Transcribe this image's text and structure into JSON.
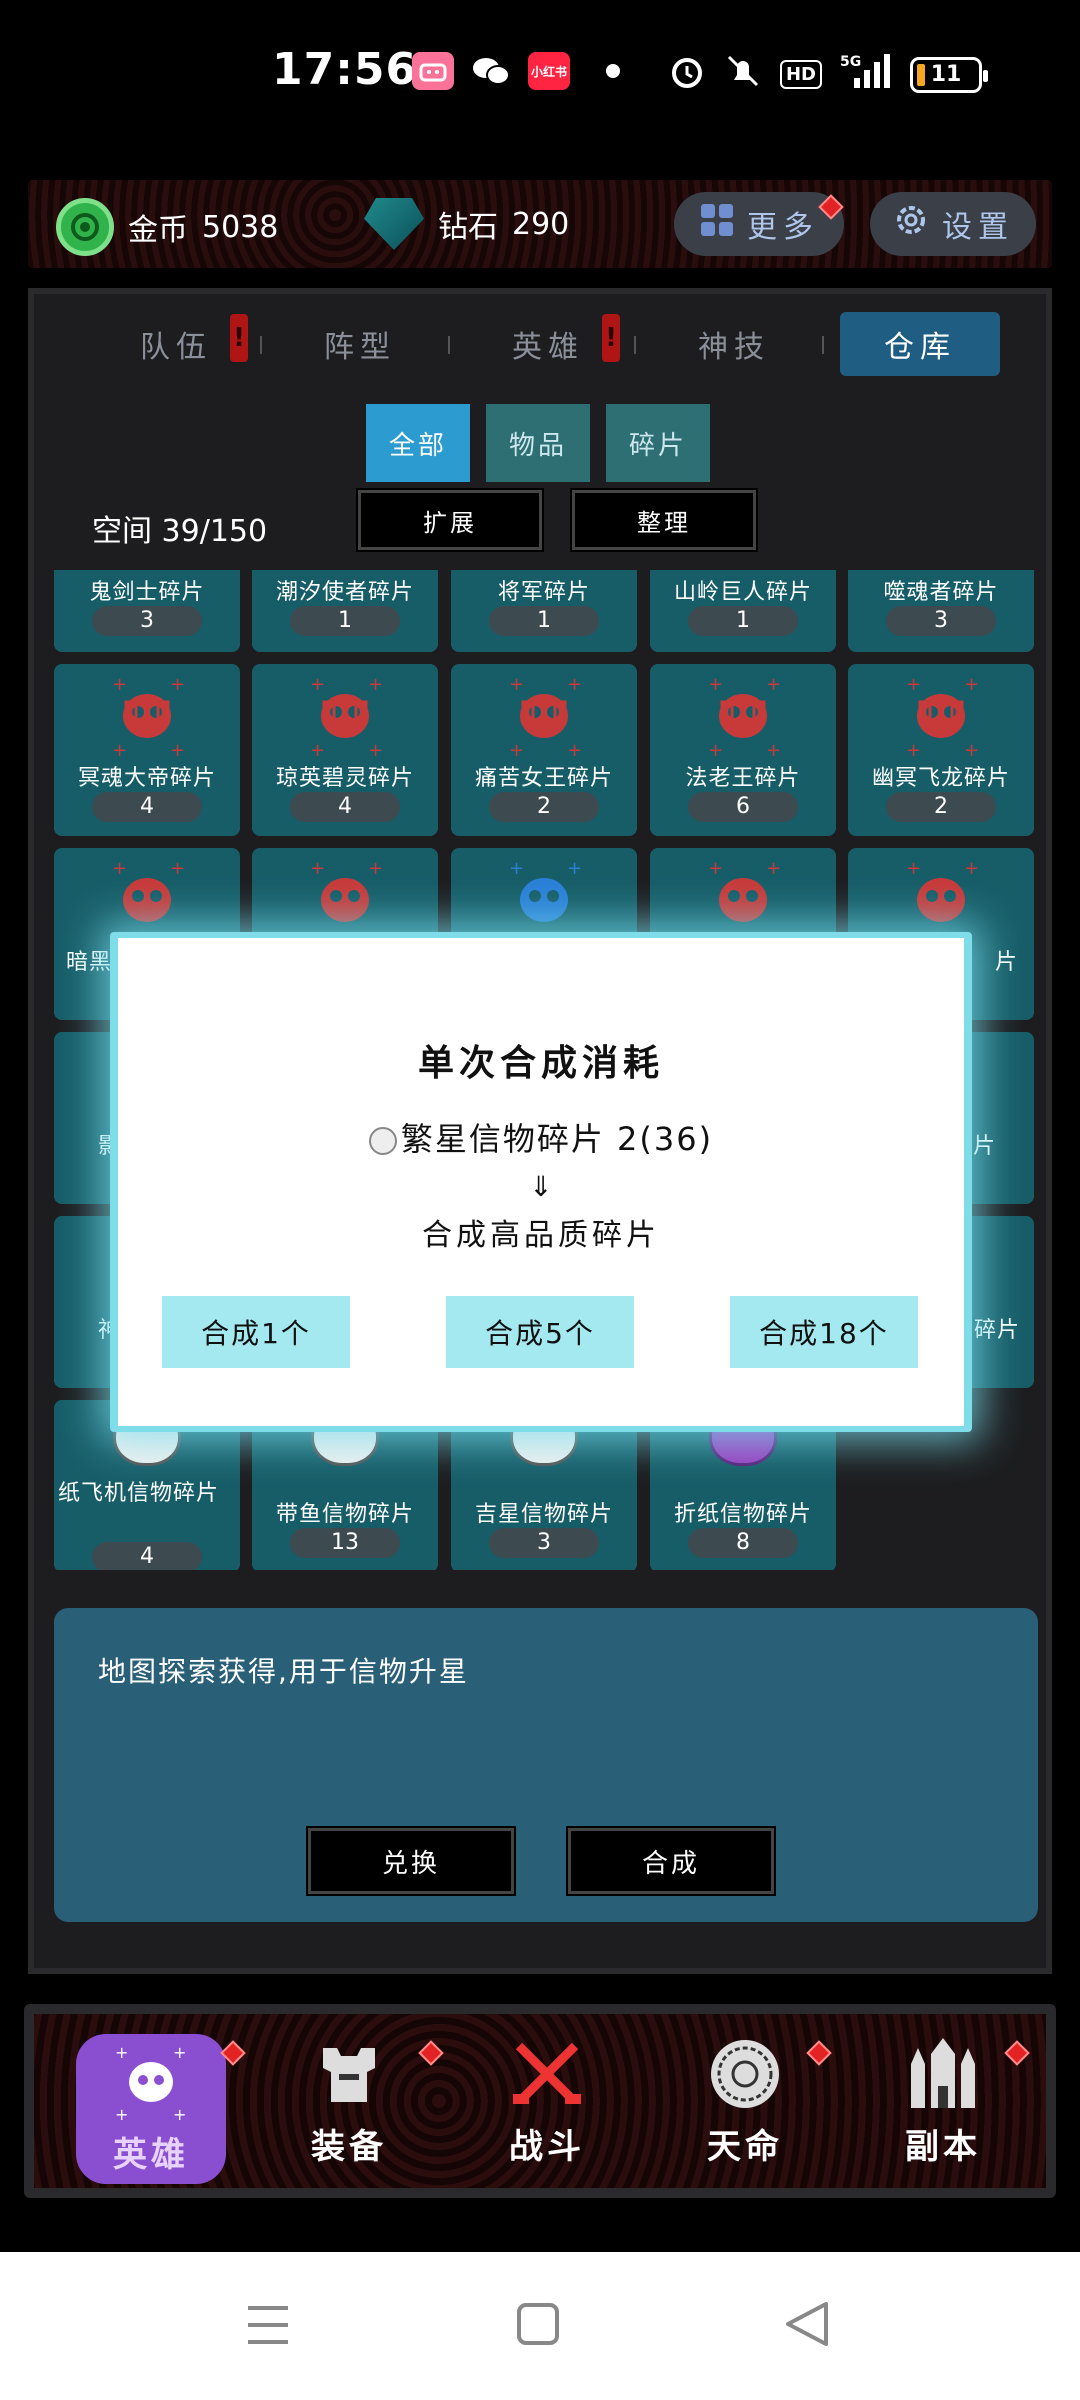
{
  "status_bar": {
    "time": "17:56",
    "icons": [
      "bilibili-icon",
      "wechat-icon",
      "xiaohongshu-icon",
      "dot-icon",
      "alarm-icon",
      "mute-icon",
      "hd-icon",
      "5g-signal-icon",
      "battery-icon"
    ],
    "xhs_label": "小红书",
    "hd_label": "HD",
    "net_label": "5G",
    "battery": "11"
  },
  "resources": {
    "coin_label": "金币",
    "coin_value": "5038",
    "diamond_label": "钻石",
    "diamond_value": "290",
    "more_label": "更多",
    "settings_label": "设置"
  },
  "tabs": [
    {
      "label": "队伍",
      "alert": true
    },
    {
      "label": "阵型",
      "alert": false
    },
    {
      "label": "英雄",
      "alert": true
    },
    {
      "label": "神技",
      "alert": false
    },
    {
      "label": "仓库",
      "alert": false,
      "active": true
    }
  ],
  "alert_mark": "!",
  "filters": [
    "全部",
    "物品",
    "碎片"
  ],
  "storage": {
    "space_label": "空间 39/150",
    "expand_label": "扩展",
    "sort_label": "整理"
  },
  "grid": {
    "row1": [
      {
        "name": "鬼剑士碎片",
        "count": "3"
      },
      {
        "name": "潮汐使者碎片",
        "count": "1"
      },
      {
        "name": "将军碎片",
        "count": "1"
      },
      {
        "name": "山岭巨人碎片",
        "count": "1"
      },
      {
        "name": "噬魂者碎片",
        "count": "3"
      }
    ],
    "row2": [
      {
        "name": "冥魂大帝碎片",
        "count": "4"
      },
      {
        "name": "琼英碧灵碎片",
        "count": "4"
      },
      {
        "name": "痛苦女王碎片",
        "count": "2"
      },
      {
        "name": "法老王碎片",
        "count": "6"
      },
      {
        "name": "幽冥飞龙碎片",
        "count": "2"
      }
    ],
    "row3_names": {
      "first": "暗黑",
      "last": "片"
    },
    "row4_names": {
      "first": "影",
      "last": "片"
    },
    "row5_names": {
      "first": "神",
      "last": "碎片"
    },
    "row6": [
      {
        "name": "纸飞机信物碎片",
        "count": "4"
      },
      {
        "name": "带鱼信物碎片",
        "count": "13"
      },
      {
        "name": "吉星信物碎片",
        "count": "3"
      },
      {
        "name": "折纸信物碎片",
        "count": "8"
      }
    ]
  },
  "description": {
    "text": "地图探索获得,用于信物升星",
    "exchange_label": "兑换",
    "synthesize_label": "合成"
  },
  "modal": {
    "title": "单次合成消耗",
    "cost": "繁星信物碎片 2(36)",
    "arrow": "⇓",
    "result": "合成高品质碎片",
    "buttons": [
      "合成1个",
      "合成5个",
      "合成18个"
    ]
  },
  "bottom_nav": [
    {
      "label": "英雄",
      "icon": "hero-skull-icon",
      "active": true
    },
    {
      "label": "装备",
      "icon": "armor-icon",
      "active": false
    },
    {
      "label": "战斗",
      "icon": "crossed-swords-icon",
      "active": false
    },
    {
      "label": "天命",
      "icon": "destiny-medallion-icon",
      "active": false
    },
    {
      "label": "副本",
      "icon": "castle-icon",
      "active": false
    }
  ],
  "system_nav": [
    "menu-icon",
    "home-square-icon",
    "back-triangle-icon"
  ],
  "colors": {
    "accent_active_tab": "#1f5e82",
    "cell_bg": "#175d68",
    "modal_button": "#a4e9f0",
    "alert_red": "#b01515",
    "nav_active": "#8a4fd1"
  }
}
